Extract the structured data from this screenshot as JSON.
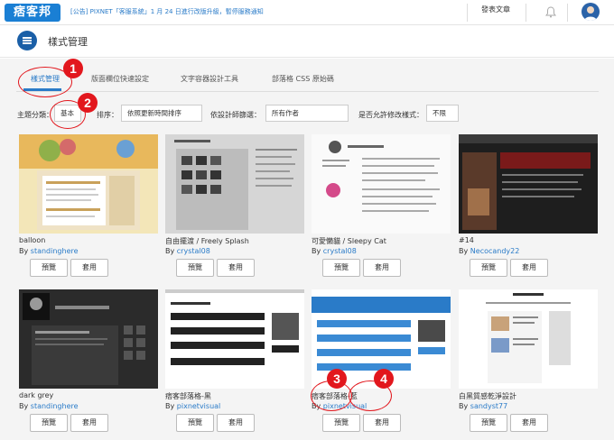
{
  "header": {
    "logo_text": "痞客邦",
    "notice": "[公告] PIXNET「客服系統」1 月 24 日進行改版升級，暫停服務通知",
    "publish_label": "發表文章"
  },
  "page": {
    "title": "樣式管理"
  },
  "tabs": [
    {
      "label": "樣式管理",
      "active": true
    },
    {
      "label": "版面欄位快速設定",
      "active": false
    },
    {
      "label": "文字容器設計工具",
      "active": false
    },
    {
      "label": "部落格 CSS 原始碼",
      "active": false
    }
  ],
  "filters": {
    "category_label": "主題分類：",
    "category_value": "基本",
    "sort_label": "排序：",
    "sort_value": "依照更新時間排序",
    "designer_label": "依設計師篩選：",
    "designer_value": "所有作者",
    "editable_label": "是否允許修改樣式：",
    "editable_value": "不限"
  },
  "buttons": {
    "preview": "預覽",
    "apply": "套用"
  },
  "themes": [
    {
      "title": "balloon",
      "by": "By",
      "author": "standinghere"
    },
    {
      "title": "自由擺渡 / Freely Splash",
      "by": "By",
      "author": "crystal08"
    },
    {
      "title": "可愛懶貓 / Sleepy Cat",
      "by": "By",
      "author": "crystal08"
    },
    {
      "title": "#14",
      "by": "By",
      "author": "Necocandy22"
    },
    {
      "title": "dark grey",
      "by": "By",
      "author": "standinghere"
    },
    {
      "title": "痞客部落格-黑",
      "by": "By",
      "author": "pixnetvisual"
    },
    {
      "title": "痞客部落格-藍",
      "by": "By",
      "author": "pixnetvisual"
    },
    {
      "title": "白黑質感乾淨設計",
      "by": "By",
      "author": "sandyst77"
    }
  ],
  "annotations": [
    "1",
    "2",
    "3",
    "4"
  ],
  "colors": {
    "accent": "#2a7bc8",
    "annotation": "#e2171d",
    "menu": "#1a5fa7"
  }
}
